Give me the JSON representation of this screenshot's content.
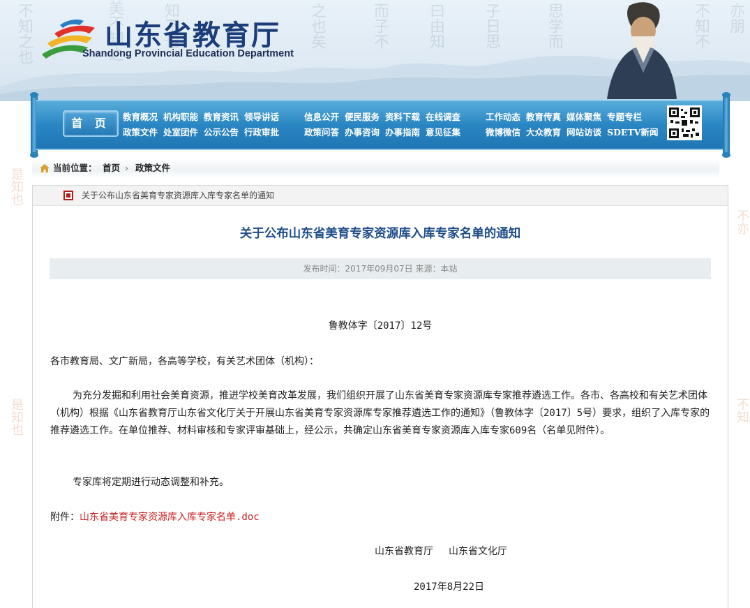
{
  "site": {
    "name_cn": "山东省教育厅",
    "name_en": "Shandong Provincial Education Department"
  },
  "nav": {
    "home": "首 页",
    "group1_row1": [
      "教育概况",
      "机构职能",
      "教育资讯",
      "领导讲话"
    ],
    "group1_row2": [
      "政策文件",
      "处室团件",
      "公示公告",
      "行政审批"
    ],
    "group2_row1": [
      "信息公开",
      "便民服务",
      "资料下载",
      "在线调查"
    ],
    "group2_row2": [
      "政策问答",
      "办事咨询",
      "办事指南",
      "意见征集"
    ],
    "group3_row1": [
      "工作动态",
      "教育传真",
      "媒体聚焦",
      "专题专栏"
    ],
    "group3_row2": [
      "微博微信",
      "大众教育",
      "网站访谈",
      "SDETV新闻"
    ]
  },
  "breadcrumb": {
    "label": "当前位置：",
    "home": "首页",
    "separator": "›",
    "current": "政策文件"
  },
  "article": {
    "tab_title": "关于公布山东省美育专家资源库入库专家名单的通知",
    "title": "关于公布山东省美育专家资源库入库专家名单的通知",
    "meta": "发布时间：2017年09月07日 来源：本站",
    "doc_no": "鲁教体字〔2017〕12号",
    "addressee": "各市教育局、文广新局，各高等学校，有关艺术团体（机构）：",
    "body1": "为充分发掘和利用社会美育资源，推进学校美育改革发展，我们组织开展了山东省美育专家资源库专家推荐遴选工作。各市、各高校和有关艺术团体（机构）根据《山东省教育厅山东省文化厅关于开展山东省美育专家资源库专家推荐遴选工作的通知》（鲁教体字〔2017〕5号）要求，组织了入库专家的推荐遴选工作。在单位推荐、材料审核和专家评审基础上，经公示，共确定山东省美育专家资源库入库专家609名（名单见附件）。",
    "body2": "专家库将定期进行动态调整和补充。",
    "attach_label": "附件：",
    "attach_link": "山东省美育专家资源库入库专家名单.doc",
    "signer1": "山东省教育厅",
    "signer2": "山东省文化厅",
    "date": "2017年8月22日"
  },
  "colors": {
    "brand_blue": "#1b3d7a",
    "nav_blue": "#2a86c3",
    "title_blue": "#1e4d8a",
    "link_red": "#cc2222"
  },
  "icons": [
    "home-icon",
    "qr-code-icon",
    "tab-marker-icon",
    "chevron-right-icon"
  ]
}
